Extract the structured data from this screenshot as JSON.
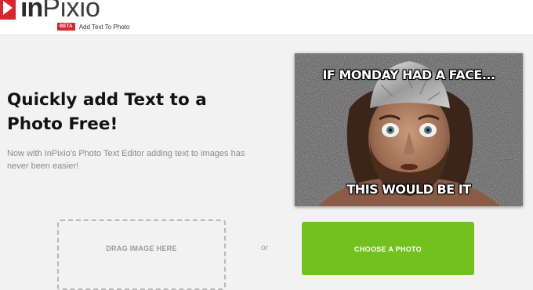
{
  "header": {
    "logo_text_bold": "in",
    "logo_text_light": "Pixio",
    "logo_icon": "play-triangle-icon",
    "badge": "BETA",
    "subtitle": "Add Text To Photo"
  },
  "hero": {
    "headline": "Quickly add Text to a Photo Free!",
    "description": "Now with InPixio's Photo Text Editor adding text to images has never been easier!"
  },
  "meme": {
    "top_text": "IF MONDAY HAD A FACE...",
    "bottom_text": "THIS WOULD BE IT"
  },
  "upload": {
    "drop_label": "DRAG IMAGE HERE",
    "or_label": "or",
    "choose_button": "CHOOSE A PHOTO"
  },
  "colors": {
    "brand_red": "#d7262e",
    "button_green": "#72c11f"
  }
}
